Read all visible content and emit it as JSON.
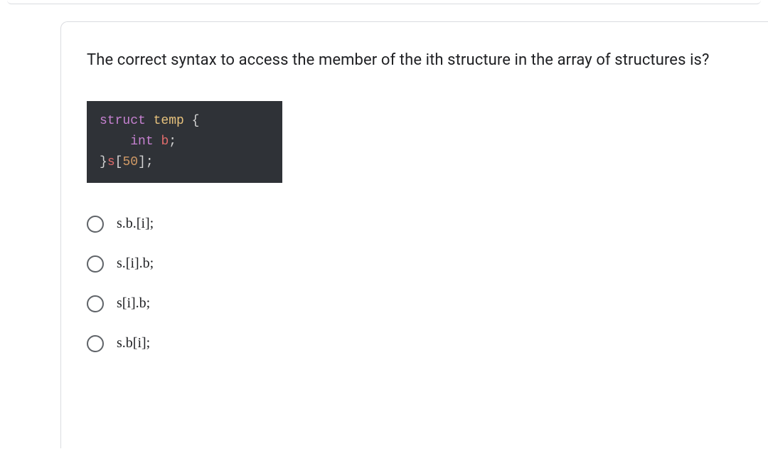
{
  "question": "The correct syntax to access the member of the ith structure in the array of structures is?",
  "code": {
    "line1_kw": "struct",
    "line1_name": "temp",
    "line1_brace": "{",
    "line2_indent": "    ",
    "line2_type": "int",
    "line2_var": "b",
    "line2_semi": ";",
    "line3_brace": "}",
    "line3_var": "s",
    "line3_lbrack": "[",
    "line3_num": "50",
    "line3_rbrack": "];"
  },
  "options": [
    {
      "label": "s.b.[i];"
    },
    {
      "label": "s.[i].b;"
    },
    {
      "label": "s[i].b;"
    },
    {
      "label": "s.b[i];"
    }
  ]
}
